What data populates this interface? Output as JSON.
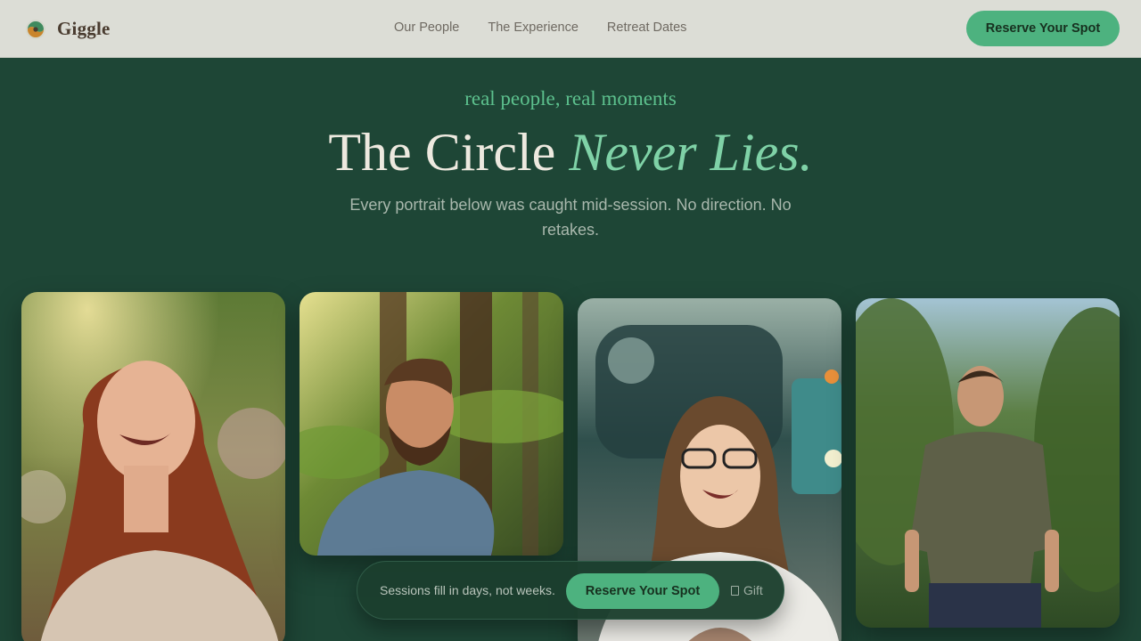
{
  "header": {
    "brand": "Giggle",
    "nav": [
      "Our People",
      "The Experience",
      "Retreat Dates"
    ],
    "cta": "Reserve Your Spot"
  },
  "hero": {
    "eyebrow": "real people, real moments",
    "title_main": "The Circle ",
    "title_accent": "Never Lies.",
    "subtitle": "Every portrait below was caught mid-session. No direction. No retakes."
  },
  "gallery": [
    {
      "name": "portrait-woman-laughing-garden"
    },
    {
      "name": "portrait-man-laughing-forest"
    },
    {
      "name": "portrait-woman-glasses-station"
    },
    {
      "name": "portrait-man-standing-trees"
    }
  ],
  "sticky_bar": {
    "text": "Sessions fill in days, not weeks.",
    "cta": "Reserve Your Spot",
    "gift": "Gift",
    "gift_icon": "gift-icon"
  },
  "colors": {
    "background": "#1e4636",
    "accent": "#4db27f",
    "header_bg": "#dcddd6"
  }
}
